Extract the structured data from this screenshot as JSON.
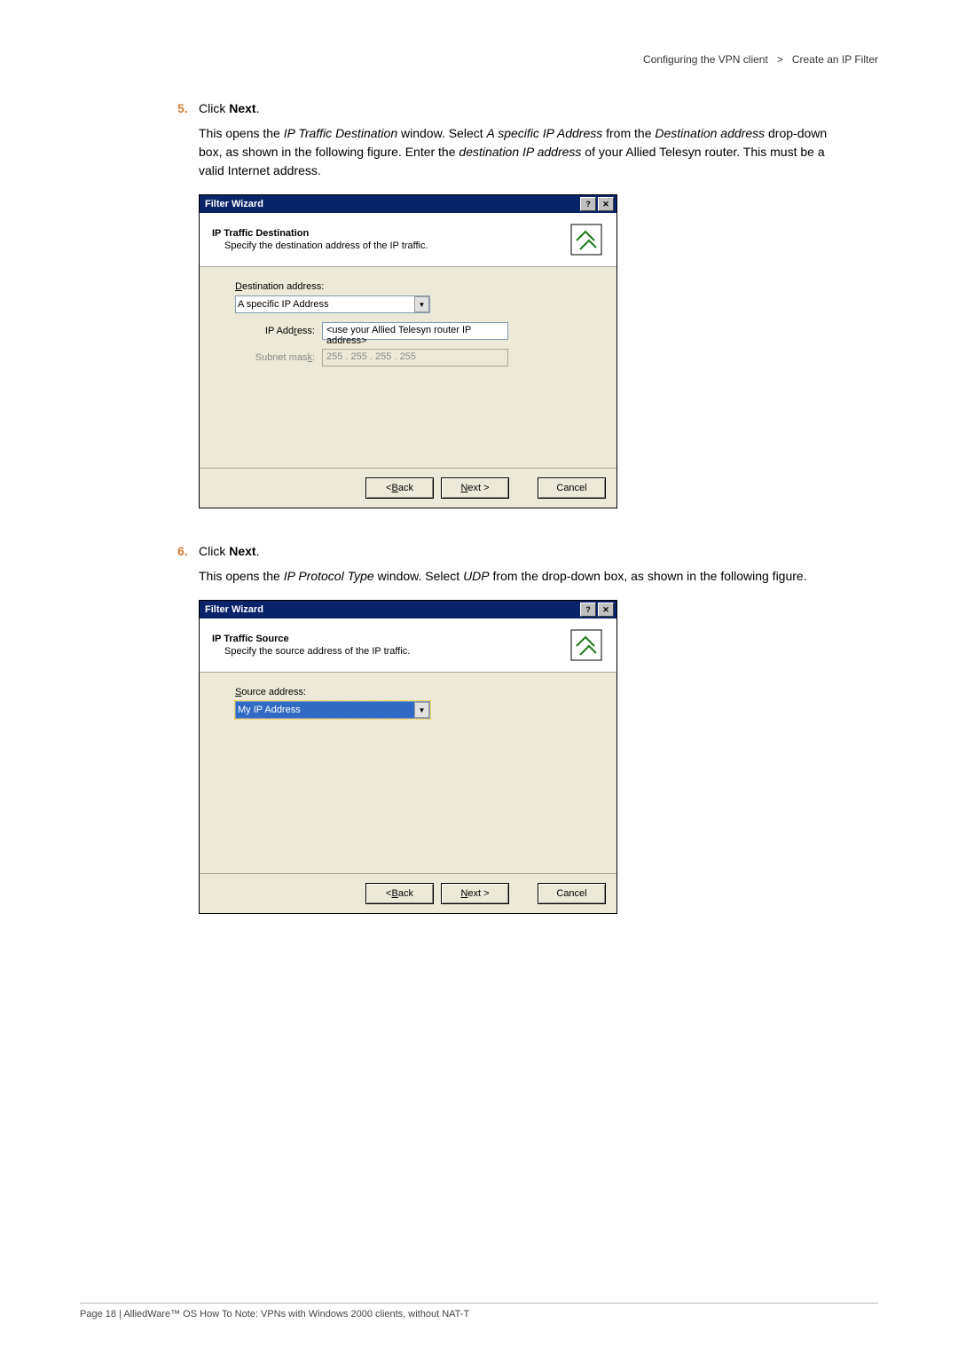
{
  "breadcrumb": {
    "section": "Configuring the VPN client",
    "sep": ">",
    "page": "Create an IP Filter"
  },
  "step5": {
    "num": "5.",
    "label_prefix": "Click ",
    "label_bold": "Next",
    "label_suffix": ".",
    "para": "This opens the IP Traffic Destination window. Select A specific IP Address from the Destination address drop-down box, as shown in the following figure. Enter the destination IP address of your Allied Telesyn router. This must be a valid Internet address."
  },
  "wizard1": {
    "titlebar": "Filter Wizard",
    "header_title": "IP Traffic Destination",
    "header_sub": "Specify the destination address of the IP traffic.",
    "dest_label_pre": "D",
    "dest_label_post": "estination address:",
    "dest_value": "A specific IP Address",
    "ip_label_pre": "IP Add",
    "ip_label_u": "r",
    "ip_label_post": "ess:",
    "ip_value": "<use your Allied Telesyn router IP address>",
    "mask_label_pre": "Subnet mas",
    "mask_label_u": "k",
    "mask_label_post": ":",
    "mask_value": "255 . 255 . 255 . 255",
    "btn_back_pre": "< ",
    "btn_back_u": "B",
    "btn_back_post": "ack",
    "btn_next_u": "N",
    "btn_next_post": "ext >",
    "btn_cancel": "Cancel"
  },
  "step6": {
    "num": "6.",
    "label_prefix": "Click ",
    "label_bold": "Next",
    "label_suffix": ".",
    "para": "This opens the IP Protocol Type window. Select UDP from the drop-down box, as shown in the following figure."
  },
  "wizard2": {
    "titlebar": "Filter Wizard",
    "header_title": "IP Traffic Source",
    "header_sub": "Specify the source address of the IP traffic.",
    "src_label_pre": "S",
    "src_label_post": "ource address:",
    "src_value": "My IP Address",
    "btn_back_pre": "< ",
    "btn_back_u": "B",
    "btn_back_post": "ack",
    "btn_next_u": "N",
    "btn_next_post": "ext >",
    "btn_cancel": "Cancel"
  },
  "footer": "Page 18 | AlliedWare™ OS How To Note: VPNs with Windows 2000 clients, without NAT-T"
}
